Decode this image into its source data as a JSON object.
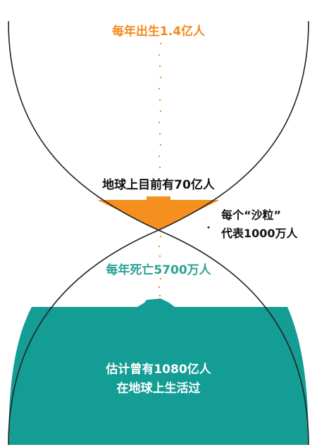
{
  "colors": {
    "outline": "#222222",
    "top_sand": "#f5901e",
    "bottom_sand": "#139d94",
    "births_text": "#f08a1c",
    "deaths_text": "#2aa294",
    "dark_text": "#111111",
    "white_text": "#ffffff"
  },
  "labels": {
    "births": "每年出生1.4亿人",
    "current": "地球上目前有70亿人",
    "grain_line1": "每个“沙粒”",
    "grain_line2": "代表1000万人",
    "deaths": "每年死亡5700万人",
    "lived_line1": "估计曾有1080亿人",
    "lived_line2": "在地球上生活过"
  }
}
